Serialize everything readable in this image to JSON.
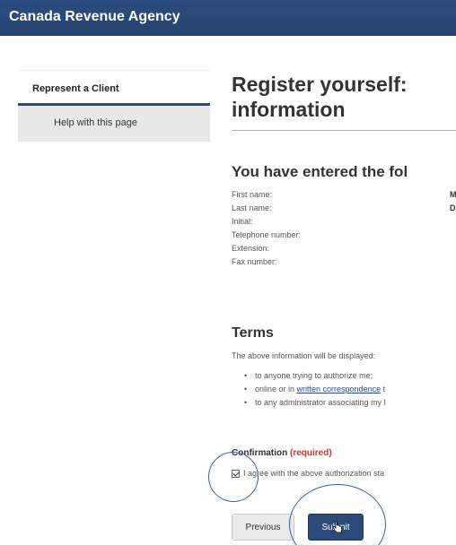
{
  "header": {
    "title": "Canada Revenue Agency"
  },
  "sidebar": {
    "heading": "Represent a Client",
    "link": "Help with this page"
  },
  "main": {
    "title_line1": "Register yourself:",
    "title_line2": "information",
    "entered_heading": "You have entered the fol",
    "fields": [
      {
        "label": "First name:",
        "value": "M"
      },
      {
        "label": "Last name:",
        "value": "D"
      },
      {
        "label": "Initial:",
        "value": ""
      },
      {
        "label": "Telephone number:",
        "value": ""
      },
      {
        "label": "Extension:",
        "value": ""
      },
      {
        "label": "Fax number:",
        "value": ""
      }
    ],
    "terms": {
      "heading": "Terms",
      "intro": "The above information will be displayed:",
      "item1": "to anyone trying to authorize me;",
      "item2_prefix": "online or in ",
      "item2_link": "written correspondence",
      "item2_suffix": " t",
      "item3": "to any administrator associating my I"
    },
    "confirmation": {
      "label": "Confirmation",
      "required": "(required)",
      "agree_text": "I agree with the above authorization sta",
      "checked": true
    },
    "buttons": {
      "previous": "Previous",
      "submit": "Submit"
    }
  },
  "colors": {
    "header_bg": "#2b4a7a",
    "required": "#d0312d",
    "link": "#2b4a9a",
    "annotation_circle": "#3a5fa8"
  }
}
